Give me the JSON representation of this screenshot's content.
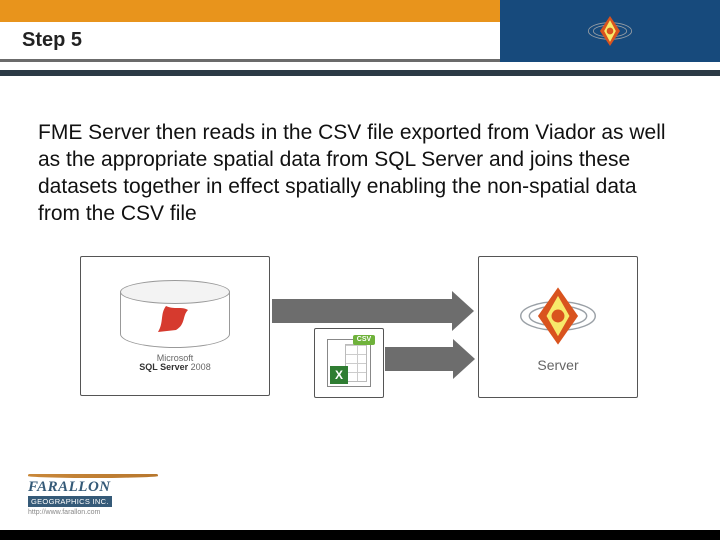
{
  "header": {
    "title": "Step 5"
  },
  "body": {
    "paragraph": "FME Server then reads in the CSV file exported from Viador as well as the appropriate spatial data from SQL Server  and joins these datasets together in effect spatially enabling the non-spatial data from the CSV file"
  },
  "diagram": {
    "sql": {
      "brand_prefix": "Microsoft",
      "product": "SQL Server",
      "version": "2008"
    },
    "csv": {
      "badge": "CSV",
      "x": "X"
    },
    "server": {
      "label": "Server"
    }
  },
  "footer": {
    "company": "FARALLON",
    "sub": "GEOGRAPHICS INC.",
    "url": "http://www.farallon.com"
  }
}
